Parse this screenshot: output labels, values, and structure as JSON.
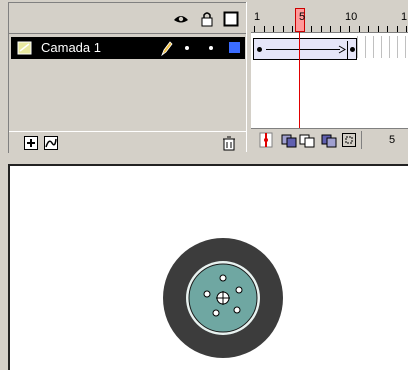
{
  "layers": {
    "items": [
      {
        "name": "Camada 1",
        "selected": true,
        "color": "#3b6cff"
      }
    ]
  },
  "timeline": {
    "ruler_labels": [
      "1",
      "5",
      "10",
      "1"
    ],
    "current_frame": 5,
    "footer_frame": "5",
    "playhead_color": "#ff0000"
  },
  "colors": {
    "panel": "#d4d0c8",
    "stage": "#ffffff",
    "wheel_tire": "#3c3c3c",
    "wheel_hub": "#6fa7a2"
  }
}
